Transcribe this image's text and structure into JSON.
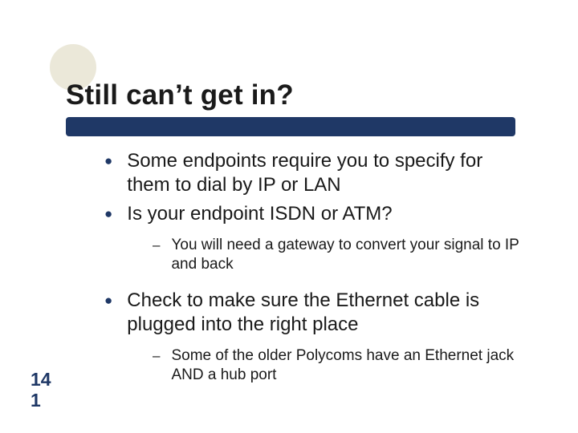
{
  "title": "Still can’t get in?",
  "bullets": {
    "b1": "Some endpoints require you to specify for them to dial by IP or LAN",
    "b2": "Is your endpoint ISDN or ATM?",
    "b2_sub1": "You will need a gateway to convert your signal to IP and back",
    "b3": "Check to make sure the Ethernet cable is plugged into the right place",
    "b3_sub1": "Some of the older Polycoms have an Ethernet jack AND a hub port"
  },
  "slide_number_top": "14",
  "slide_number_bottom": "1",
  "glyphs": {
    "dot": "●",
    "dash": "–"
  }
}
